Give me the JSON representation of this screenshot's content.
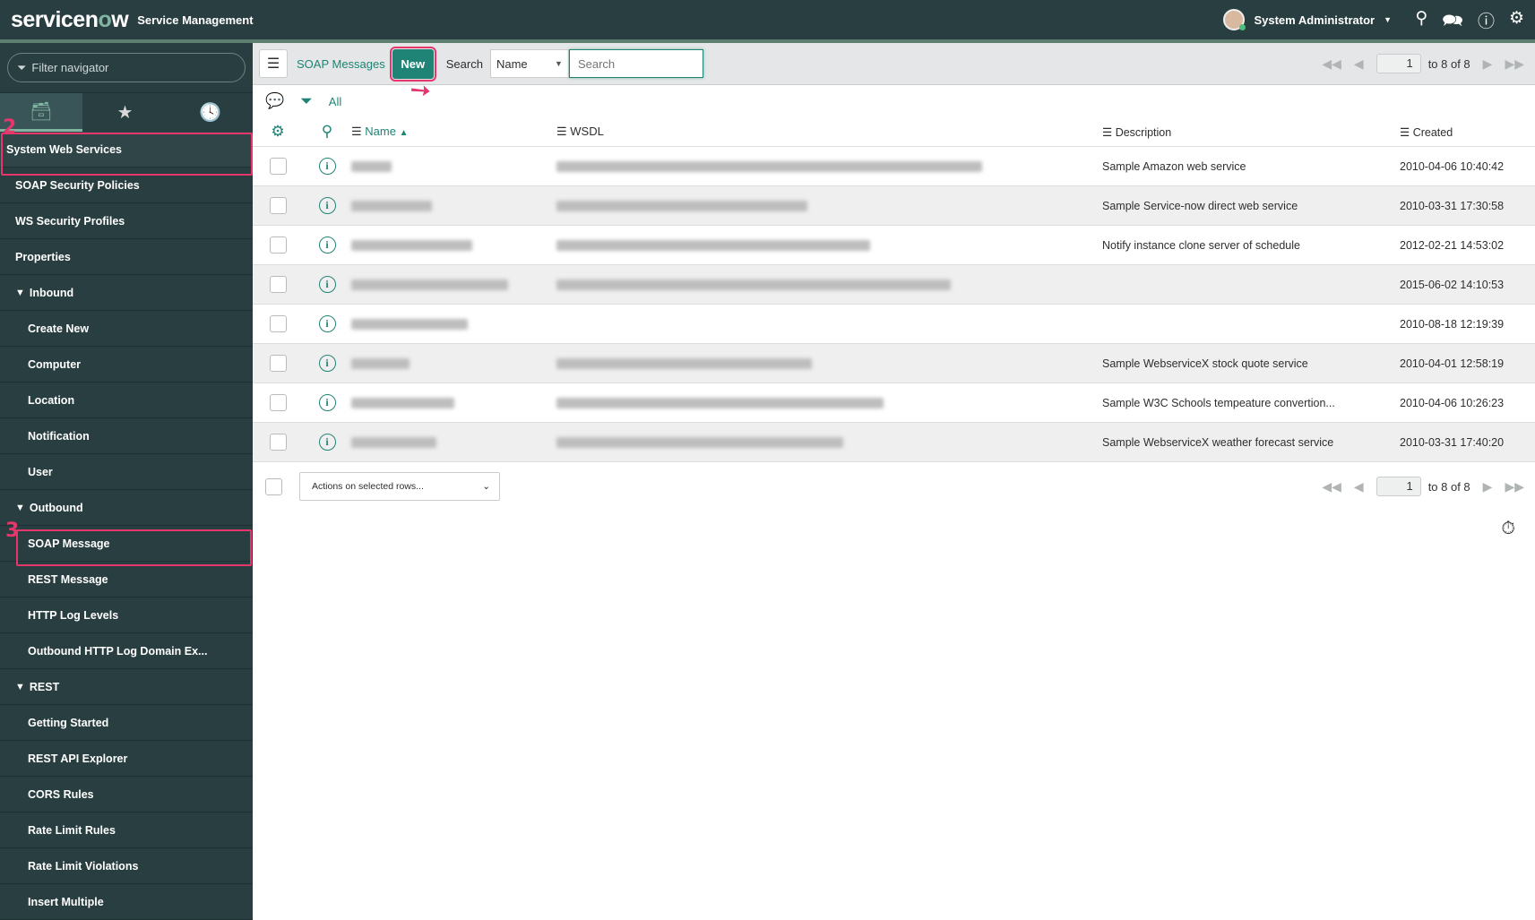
{
  "header": {
    "logo": "servicenow",
    "app_title": "Service Management",
    "user_name": "System Administrator",
    "icons": [
      "search-icon",
      "chat-icon",
      "help-icon",
      "gear-icon"
    ]
  },
  "sidebar": {
    "filter_placeholder": "Filter navigator",
    "tabs": [
      "all-apps-icon",
      "favorites-star-icon",
      "history-clock-icon"
    ],
    "items": [
      {
        "label": "System Web Services",
        "level": 0
      },
      {
        "label": "SOAP Security Policies",
        "level": 1
      },
      {
        "label": "WS Security Profiles",
        "level": 1
      },
      {
        "label": "Properties",
        "level": 1
      },
      {
        "label": "Inbound",
        "level": 1,
        "section": true
      },
      {
        "label": "Create New",
        "level": 2
      },
      {
        "label": "Computer",
        "level": 2
      },
      {
        "label": "Location",
        "level": 2
      },
      {
        "label": "Notification",
        "level": 2
      },
      {
        "label": "User",
        "level": 2
      },
      {
        "label": "Outbound",
        "level": 1,
        "section": true
      },
      {
        "label": "SOAP Message",
        "level": 2
      },
      {
        "label": "REST Message",
        "level": 2
      },
      {
        "label": "HTTP Log Levels",
        "level": 2
      },
      {
        "label": "Outbound HTTP Log Domain Ex...",
        "level": 2
      },
      {
        "label": "REST",
        "level": 1,
        "section": true
      },
      {
        "label": "Getting Started",
        "level": 2
      },
      {
        "label": "REST API Explorer",
        "level": 2
      },
      {
        "label": "CORS Rules",
        "level": 2
      },
      {
        "label": "Rate Limit Rules",
        "level": 2
      },
      {
        "label": "Rate Limit Violations",
        "level": 2
      },
      {
        "label": "Insert Multiple",
        "level": 2
      }
    ]
  },
  "annotations": {
    "step2": "2",
    "step3": "3"
  },
  "toolbar": {
    "title": "SOAP Messages",
    "new_label": "New",
    "search_label": "Search",
    "search_field": "Name",
    "search_placeholder": "Search",
    "page": "1",
    "page_text": "to 8 of 8"
  },
  "filterbar": {
    "all_label": "All"
  },
  "table": {
    "columns": [
      "Name",
      "WSDL",
      "Description",
      "Created"
    ],
    "rows": [
      {
        "description": "Sample Amazon web service",
        "created": "2010-04-06 10:40:42"
      },
      {
        "description": "Sample Service-now direct web service",
        "created": "2010-03-31 17:30:58"
      },
      {
        "description": "Notify instance clone server of schedule",
        "created": "2012-02-21 14:53:02"
      },
      {
        "description": "",
        "created": "2015-06-02 14:10:53"
      },
      {
        "description": "",
        "created": "2010-08-18 12:19:39"
      },
      {
        "description": "Sample WebserviceX stock quote service",
        "created": "2010-04-01 12:58:19"
      },
      {
        "description": "Sample W3C Schools tempeature convertion...",
        "created": "2010-04-06 10:26:23"
      },
      {
        "description": "Sample WebserviceX weather forecast service",
        "created": "2010-03-31 17:40:20"
      }
    ]
  },
  "footer": {
    "actions_label": "Actions on selected rows...",
    "page": "1",
    "page_text": "to 8 of 8"
  },
  "colors": {
    "header_bg": "#293e40",
    "accent": "#1f8476",
    "highlight": "#e6366c"
  }
}
